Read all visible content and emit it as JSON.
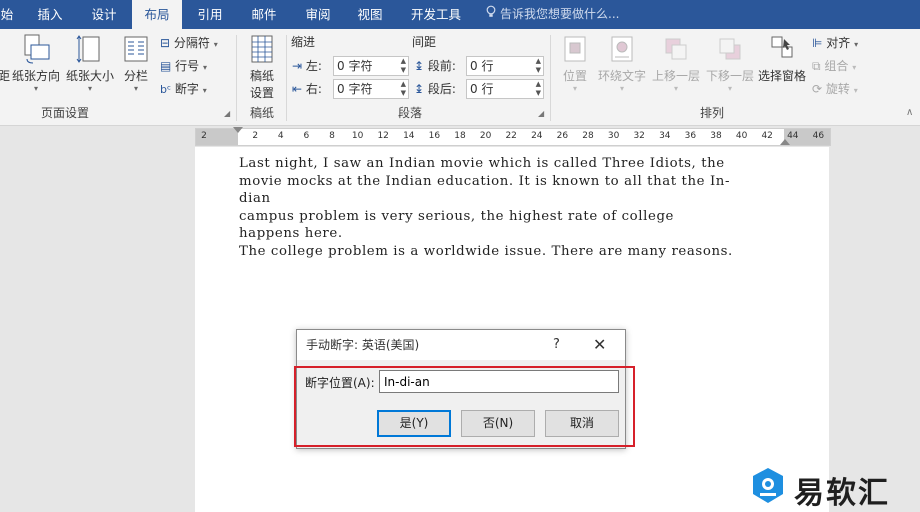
{
  "tabs": [
    {
      "label": "始",
      "active": false
    },
    {
      "label": "插入",
      "active": false
    },
    {
      "label": "设计",
      "active": false
    },
    {
      "label": "布局",
      "active": true
    },
    {
      "label": "引用",
      "active": false
    },
    {
      "label": "邮件",
      "active": false
    },
    {
      "label": "审阅",
      "active": false
    },
    {
      "label": "视图",
      "active": false
    },
    {
      "label": "开发工具",
      "active": false
    }
  ],
  "tell_me": "告诉我您想要做什么...",
  "ribbon": {
    "page_setup": {
      "margins_fragment": "距",
      "orientation": "纸张方向",
      "size": "纸张大小",
      "columns": "分栏",
      "breaks": "分隔符",
      "line_numbers": "行号",
      "hyphenation": "断字",
      "label": "页面设置"
    },
    "draft": {
      "button": "稿纸\n设置",
      "button_line1": "稿纸",
      "button_line2": "设置",
      "label": "稿纸"
    },
    "paragraph": {
      "indent_header": "缩进",
      "spacing_header": "间距",
      "left_label": "左:",
      "right_label": "右:",
      "before_label": "段前:",
      "after_label": "段后:",
      "left_value": "0 字符",
      "right_value": "0 字符",
      "before_value": "0 行",
      "after_value": "0 行",
      "label": "段落"
    },
    "arrange": {
      "position": "位置",
      "wrap_text": "环绕文字",
      "bring_forward": "上移一层",
      "send_backward": "下移一层",
      "selection_pane": "选择窗格",
      "align": "对齐",
      "group": "组合",
      "rotate": "旋转",
      "label": "排列"
    }
  },
  "ruler": {
    "ticks": [
      "2",
      "",
      "2",
      "4",
      "6",
      "8",
      "10",
      "12",
      "14",
      "16",
      "18",
      "20",
      "22",
      "24",
      "26",
      "28",
      "30",
      "32",
      "34",
      "36",
      "38",
      "40",
      "42",
      "44",
      "46"
    ]
  },
  "document": {
    "lines": [
      "Last night, I saw an Indian movie which is called Three Idiots, the",
      "movie mocks at the Indian education. It is known to all that the In-",
      "dian",
      "campus problem is very serious, the highest rate of college",
      "happens here.",
      "The college problem is a worldwide issue. There are many reasons."
    ]
  },
  "dialog": {
    "title": "手动断字: 英语(美国)",
    "help": "?",
    "close": "✕",
    "field_label": "断字位置(A):",
    "field_value": "In-di-an",
    "yes_button": "是(Y)",
    "no_button": "否(N)",
    "cancel_button": "取消"
  },
  "watermark": {
    "text": "易软汇"
  },
  "colors": {
    "tab_bar": "#2b579a",
    "ribbon": "#f3f3f3",
    "highlight": "#d6202a",
    "logo_blue": "#1e8fe0"
  }
}
